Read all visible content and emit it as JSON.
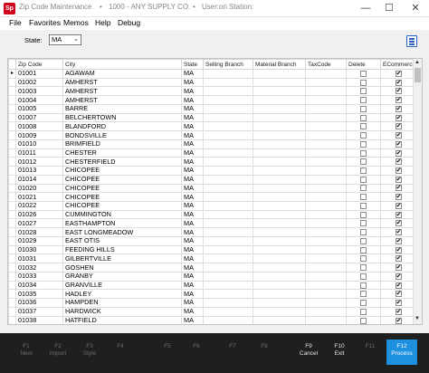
{
  "title_bar": {
    "app_icon": "Sp",
    "segments": [
      "Zip Code Maintenance",
      "•",
      "1000 - ANY SUPPLY CO.",
      "•",
      "User:",
      "on Station:"
    ],
    "minimize_icon": "minimize-icon",
    "maximize_icon": "maximize-icon",
    "close_icon": "close-icon"
  },
  "menu": [
    "File",
    "Favorites",
    "Memos",
    "Help",
    "Debug"
  ],
  "filter": {
    "label": "State:",
    "value": "MA"
  },
  "grid": {
    "columns": [
      "Zip Code",
      "City",
      "State",
      "Selling Branch",
      "Material Branch",
      "TaxCode",
      "Delete",
      "ECommerce"
    ],
    "row_indicator": "▸",
    "rows": [
      {
        "zip": "01001",
        "city": "AGAWAM",
        "state": "MA",
        "delete": false,
        "ecommerce": true
      },
      {
        "zip": "01002",
        "city": "AMHERST",
        "state": "MA",
        "delete": false,
        "ecommerce": true
      },
      {
        "zip": "01003",
        "city": "AMHERST",
        "state": "MA",
        "delete": false,
        "ecommerce": true
      },
      {
        "zip": "01004",
        "city": "AMHERST",
        "state": "MA",
        "delete": false,
        "ecommerce": true
      },
      {
        "zip": "01005",
        "city": "BARRE",
        "state": "MA",
        "delete": false,
        "ecommerce": true
      },
      {
        "zip": "01007",
        "city": "BELCHERTOWN",
        "state": "MA",
        "delete": false,
        "ecommerce": true
      },
      {
        "zip": "01008",
        "city": "BLANDFORD",
        "state": "MA",
        "delete": false,
        "ecommerce": true
      },
      {
        "zip": "01009",
        "city": "BONDSVILLE",
        "state": "MA",
        "delete": false,
        "ecommerce": true
      },
      {
        "zip": "01010",
        "city": "BRIMFIELD",
        "state": "MA",
        "delete": false,
        "ecommerce": true
      },
      {
        "zip": "01011",
        "city": "CHESTER",
        "state": "MA",
        "delete": false,
        "ecommerce": true
      },
      {
        "zip": "01012",
        "city": "CHESTERFIELD",
        "state": "MA",
        "delete": false,
        "ecommerce": true
      },
      {
        "zip": "01013",
        "city": "CHICOPEE",
        "state": "MA",
        "delete": false,
        "ecommerce": true
      },
      {
        "zip": "01014",
        "city": "CHICOPEE",
        "state": "MA",
        "delete": false,
        "ecommerce": true
      },
      {
        "zip": "01020",
        "city": "CHICOPEE",
        "state": "MA",
        "delete": false,
        "ecommerce": true
      },
      {
        "zip": "01021",
        "city": "CHICOPEE",
        "state": "MA",
        "delete": false,
        "ecommerce": true
      },
      {
        "zip": "01022",
        "city": "CHICOPEE",
        "state": "MA",
        "delete": false,
        "ecommerce": true
      },
      {
        "zip": "01026",
        "city": "CUMMINGTON",
        "state": "MA",
        "delete": false,
        "ecommerce": true
      },
      {
        "zip": "01027",
        "city": "EASTHAMPTON",
        "state": "MA",
        "delete": false,
        "ecommerce": true
      },
      {
        "zip": "01028",
        "city": "EAST LONGMEADOW",
        "state": "MA",
        "delete": false,
        "ecommerce": true
      },
      {
        "zip": "01029",
        "city": "EAST OTIS",
        "state": "MA",
        "delete": false,
        "ecommerce": true
      },
      {
        "zip": "01030",
        "city": "FEEDING HILLS",
        "state": "MA",
        "delete": false,
        "ecommerce": true
      },
      {
        "zip": "01031",
        "city": "GILBERTVILLE",
        "state": "MA",
        "delete": false,
        "ecommerce": true
      },
      {
        "zip": "01032",
        "city": "GOSHEN",
        "state": "MA",
        "delete": false,
        "ecommerce": true
      },
      {
        "zip": "01033",
        "city": "GRANBY",
        "state": "MA",
        "delete": false,
        "ecommerce": true
      },
      {
        "zip": "01034",
        "city": "GRANVILLE",
        "state": "MA",
        "delete": false,
        "ecommerce": true
      },
      {
        "zip": "01035",
        "city": "HADLEY",
        "state": "MA",
        "delete": false,
        "ecommerce": true
      },
      {
        "zip": "01036",
        "city": "HAMPDEN",
        "state": "MA",
        "delete": false,
        "ecommerce": true
      },
      {
        "zip": "01037",
        "city": "HARDWICK",
        "state": "MA",
        "delete": false,
        "ecommerce": true
      },
      {
        "zip": "01038",
        "city": "HATFIELD",
        "state": "MA",
        "delete": false,
        "ecommerce": true
      }
    ]
  },
  "function_keys": [
    {
      "key": "F1",
      "label": "Next",
      "state": "dim"
    },
    {
      "key": "F2",
      "label": "Import",
      "state": "dim"
    },
    {
      "key": "F3",
      "label": "Style",
      "state": "dim"
    },
    {
      "key": "F4",
      "label": "",
      "state": "dim"
    },
    {
      "key": "F5",
      "label": "",
      "state": "dim"
    },
    {
      "key": "F6",
      "label": "",
      "state": "dim"
    },
    {
      "key": "F7",
      "label": "",
      "state": "dim"
    },
    {
      "key": "F8",
      "label": "",
      "state": "dim"
    },
    {
      "key": "F9",
      "label": "Cancel",
      "state": "active"
    },
    {
      "key": "F10",
      "label": "Exit",
      "state": "active"
    },
    {
      "key": "F11",
      "label": "",
      "state": "dim"
    },
    {
      "key": "F12",
      "label": "Process",
      "state": "primary"
    }
  ],
  "colors": {
    "accent": "#1e90e0",
    "footer_bg": "#1f1f1f",
    "app_icon": "#d0021b"
  }
}
